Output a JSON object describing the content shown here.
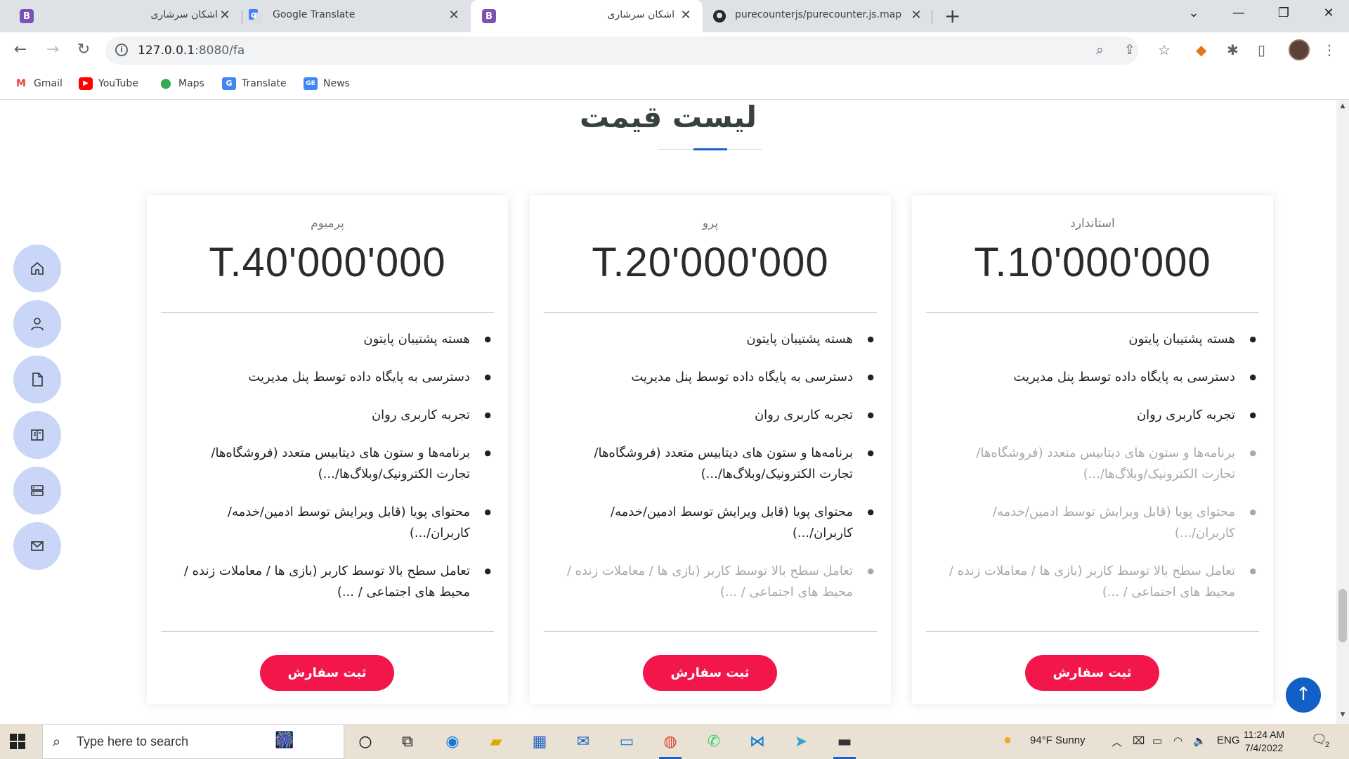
{
  "browser": {
    "tabs": [
      {
        "title": "اشکان سرشاری",
        "favicon": "bootstrap-icon",
        "active": false
      },
      {
        "title": "Google Translate",
        "favicon": "google-translate-icon",
        "active": false
      },
      {
        "title": "اشکان سرشاری",
        "favicon": "bootstrap-icon",
        "active": true
      },
      {
        "title": "purecounterjs/purecounter.js.map a",
        "favicon": "github-icon",
        "active": false
      }
    ],
    "url_host": "127.0.0.1",
    "url_path": ":8080/fa",
    "bookmarks": [
      {
        "label": "Gmail",
        "icon": "gmail-icon"
      },
      {
        "label": "YouTube",
        "icon": "youtube-icon"
      },
      {
        "label": "Maps",
        "icon": "maps-icon"
      },
      {
        "label": "Translate",
        "icon": "translate-icon"
      },
      {
        "label": "News",
        "icon": "news-icon"
      }
    ]
  },
  "page": {
    "section_title": "لیست قیمت",
    "accent_color": "#f2164b",
    "plans": [
      {
        "name": "پرمیوم",
        "price": "T.40'000'000",
        "features": [
          {
            "text": "هسته پشتیبان پایتون",
            "available": true
          },
          {
            "text": "دسترسی به پایگاه داده توسط پنل مدیریت",
            "available": true
          },
          {
            "text": "تجربه کاربری روان",
            "available": true
          },
          {
            "text": "برنامه‌ها و ستون های دیتابیس متعدد (فروشگاه‌ها/ تجارت الکترونیک/وبلاگ‌ها/...)",
            "available": true
          },
          {
            "text": "محتوای پویا (قابل ویرایش توسط ادمین/خدمه/کاربران/...)",
            "available": true
          },
          {
            "text": "تعامل سطح بالا توسط کاربر (بازی ها / معاملات زنده / محیط های اجتماعی / ...)",
            "available": true
          }
        ],
        "button": "ثبت سفارش"
      },
      {
        "name": "پرو",
        "price": "T.20'000'000",
        "features": [
          {
            "text": "هسته پشتیبان پایتون",
            "available": true
          },
          {
            "text": "دسترسی به پایگاه داده توسط پنل مدیریت",
            "available": true
          },
          {
            "text": "تجربه کاربری روان",
            "available": true
          },
          {
            "text": "برنامه‌ها و ستون های دیتابیس متعدد (فروشگاه‌ها/ تجارت الکترونیک/وبلاگ‌ها/...)",
            "available": true
          },
          {
            "text": "محتوای پویا (قابل ویرایش توسط ادمین/خدمه/کاربران/...)",
            "available": true
          },
          {
            "text": "تعامل سطح بالا توسط کاربر (بازی ها / معاملات زنده / محیط های اجتماعی / ...)",
            "available": false
          }
        ],
        "button": "ثبت سفارش"
      },
      {
        "name": "استاندارد",
        "price": "T.10'000'000",
        "features": [
          {
            "text": "هسته پشتیبان پایتون",
            "available": true
          },
          {
            "text": "دسترسی به پایگاه داده توسط پنل مدیریت",
            "available": true
          },
          {
            "text": "تجربه کاربری روان",
            "available": true
          },
          {
            "text": "برنامه‌ها و ستون های دیتابیس متعدد (فروشگاه‌ها/ تجارت الکترونیک/وبلاگ‌ها/...)",
            "available": false
          },
          {
            "text": "محتوای پویا (قابل ویرایش توسط ادمین/خدمه/کاربران/...)",
            "available": false
          },
          {
            "text": "تعامل سطح بالا توسط کاربر (بازی ها / معاملات زنده / محیط های اجتماعی / ...)",
            "available": false
          }
        ],
        "button": "ثبت سفارش"
      }
    ],
    "side_nav": [
      "home-icon",
      "person-icon",
      "document-icon",
      "book-icon",
      "server-icon",
      "envelope-icon"
    ]
  },
  "taskbar": {
    "search_placeholder": "Type here to search",
    "weather": "94°F  Sunny",
    "language": "ENG",
    "time": "11:24 AM",
    "date": "7/4/2022",
    "notifications": "2"
  }
}
